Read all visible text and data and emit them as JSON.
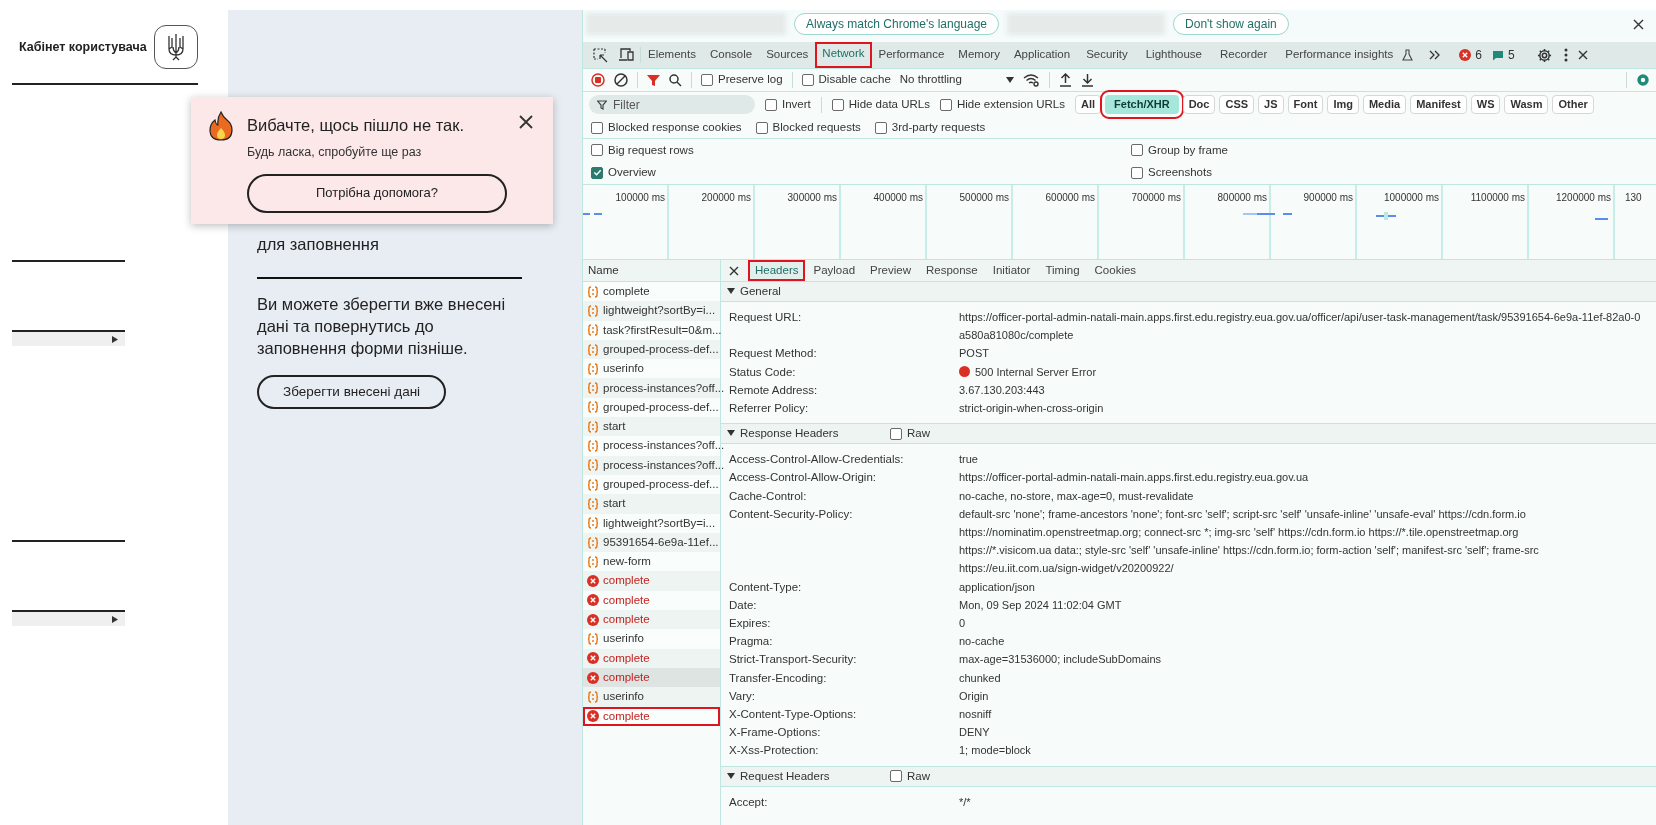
{
  "sidebar": {
    "title": "Кабінет користувача"
  },
  "main": {
    "form_note": "для заповнення",
    "save_hint": "Ви можете зберегти вже внесені дані та повернутись до заповнення форми пізніше.",
    "save_button": "Зберегти внесені дані"
  },
  "toast": {
    "title": "Вибачте, щось пішло не так.",
    "message": "Будь ласка, спробуйте ще раз",
    "button": "Потрібна допомога?"
  },
  "devtools": {
    "infobar": {
      "buttons": [
        "Always match Chrome's language",
        "Don't show again"
      ]
    },
    "tabs": [
      {
        "label": "Elements",
        "selected": false,
        "highlighted": false
      },
      {
        "label": "Console",
        "selected": false,
        "highlighted": false
      },
      {
        "label": "Sources",
        "selected": false,
        "highlighted": false
      },
      {
        "label": "Network",
        "selected": true,
        "highlighted": true
      },
      {
        "label": "Performance",
        "selected": false,
        "highlighted": false
      },
      {
        "label": "Memory",
        "selected": false,
        "highlighted": false
      },
      {
        "label": "Application",
        "selected": false,
        "highlighted": false
      },
      {
        "label": "Security",
        "selected": false,
        "highlighted": false
      },
      {
        "label": "Lighthouse",
        "selected": false,
        "highlighted": false
      },
      {
        "label": "Recorder",
        "selected": false,
        "highlighted": false
      },
      {
        "label": "Performance insights",
        "selected": false,
        "highlighted": false
      }
    ],
    "error_count": "6",
    "message_count": "5",
    "toolbar": {
      "checkboxes": [
        {
          "label": "Preserve log",
          "checked": false
        },
        {
          "label": "Disable cache",
          "checked": false
        }
      ],
      "throttling": "No throttling"
    },
    "filter": {
      "placeholder": "Filter",
      "checkboxes": [
        {
          "label": "Invert",
          "checked": false
        },
        {
          "label": "Hide data URLs",
          "checked": false
        },
        {
          "label": "Hide extension URLs",
          "checked": false
        }
      ],
      "types": [
        {
          "label": "All",
          "selected": false,
          "highlighted": false
        },
        {
          "label": "Fetch/XHR",
          "selected": true,
          "highlighted": true
        },
        {
          "label": "Doc",
          "selected": false,
          "highlighted": false
        },
        {
          "label": "CSS",
          "selected": false,
          "highlighted": false
        },
        {
          "label": "JS",
          "selected": false,
          "highlighted": false
        },
        {
          "label": "Font",
          "selected": false,
          "highlighted": false
        },
        {
          "label": "Img",
          "selected": false,
          "highlighted": false
        },
        {
          "label": "Media",
          "selected": false,
          "highlighted": false
        },
        {
          "label": "Manifest",
          "selected": false,
          "highlighted": false
        },
        {
          "label": "WS",
          "selected": false,
          "highlighted": false
        },
        {
          "label": "Wasm",
          "selected": false,
          "highlighted": false
        },
        {
          "label": "Other",
          "selected": false,
          "highlighted": false
        }
      ],
      "more_checkboxes": [
        {
          "label": "Blocked response cookies",
          "checked": false
        },
        {
          "label": "Blocked requests",
          "checked": false
        },
        {
          "label": "3rd-party requests",
          "checked": false
        }
      ]
    },
    "settings": {
      "left": [
        {
          "label": "Big request rows",
          "checked": false
        },
        {
          "label": "Overview",
          "checked": true
        }
      ],
      "right": [
        {
          "label": "Group by frame",
          "checked": false
        },
        {
          "label": "Screenshots",
          "checked": false
        }
      ]
    },
    "timeline": {
      "ticks": [
        "100000 ms",
        "200000 ms",
        "300000 ms",
        "400000 ms",
        "500000 ms",
        "600000 ms",
        "700000 ms",
        "800000 ms",
        "900000 ms",
        "1000000 ms",
        "1100000 ms",
        "1200000 ms",
        "130"
      ]
    },
    "requests": {
      "header": "Name",
      "items": [
        {
          "name": "complete",
          "kind": "fetch",
          "selected": false,
          "highlighted": false
        },
        {
          "name": "lightweight?sortBy=i...",
          "kind": "fetch",
          "selected": false,
          "highlighted": false
        },
        {
          "name": "task?firstResult=0&m...",
          "kind": "fetch",
          "selected": false,
          "highlighted": false
        },
        {
          "name": "grouped-process-def...",
          "kind": "fetch",
          "selected": false,
          "highlighted": false
        },
        {
          "name": "userinfo",
          "kind": "fetch",
          "selected": false,
          "highlighted": false
        },
        {
          "name": "process-instances?off...",
          "kind": "fetch",
          "selected": false,
          "highlighted": false
        },
        {
          "name": "grouped-process-def...",
          "kind": "fetch",
          "selected": false,
          "highlighted": false
        },
        {
          "name": "start",
          "kind": "fetch",
          "selected": false,
          "highlighted": false
        },
        {
          "name": "process-instances?off...",
          "kind": "fetch",
          "selected": false,
          "highlighted": false
        },
        {
          "name": "process-instances?off...",
          "kind": "fetch",
          "selected": false,
          "highlighted": false
        },
        {
          "name": "grouped-process-def...",
          "kind": "fetch",
          "selected": false,
          "highlighted": false
        },
        {
          "name": "start",
          "kind": "fetch",
          "selected": false,
          "highlighted": false
        },
        {
          "name": "lightweight?sortBy=i...",
          "kind": "fetch",
          "selected": false,
          "highlighted": false
        },
        {
          "name": "95391654-6e9a-11ef...",
          "kind": "fetch",
          "selected": false,
          "highlighted": false
        },
        {
          "name": "new-form",
          "kind": "fetch",
          "selected": false,
          "highlighted": false
        },
        {
          "name": "complete",
          "kind": "error",
          "selected": false,
          "highlighted": false
        },
        {
          "name": "complete",
          "kind": "error",
          "selected": false,
          "highlighted": false
        },
        {
          "name": "complete",
          "kind": "error",
          "selected": false,
          "highlighted": false
        },
        {
          "name": "userinfo",
          "kind": "fetch",
          "selected": false,
          "highlighted": false
        },
        {
          "name": "complete",
          "kind": "error",
          "selected": false,
          "highlighted": false
        },
        {
          "name": "complete",
          "kind": "error",
          "selected": true,
          "highlighted": false
        },
        {
          "name": "userinfo",
          "kind": "fetch",
          "selected": false,
          "highlighted": false
        },
        {
          "name": "complete",
          "kind": "error",
          "selected": false,
          "highlighted": true
        }
      ]
    },
    "detail_tabs": [
      {
        "label": "Headers",
        "selected": true,
        "highlighted": true
      },
      {
        "label": "Payload",
        "selected": false,
        "highlighted": false
      },
      {
        "label": "Preview",
        "selected": false,
        "highlighted": false
      },
      {
        "label": "Response",
        "selected": false,
        "highlighted": false
      },
      {
        "label": "Initiator",
        "selected": false,
        "highlighted": false
      },
      {
        "label": "Timing",
        "selected": false,
        "highlighted": false
      },
      {
        "label": "Cookies",
        "selected": false,
        "highlighted": false
      }
    ],
    "sections": [
      {
        "title": "General",
        "expanded": true,
        "rows": [
          {
            "key": "Request URL:",
            "kind": "text",
            "value": [
              "https://officer-portal-admin-natali-main.apps.first.edu.registry.eua.gov.ua/officer/api/user-task-management/task/95391654-6e9a-11ef-82a0-0",
              "a580a81080c/complete"
            ]
          },
          {
            "key": "Request Method:",
            "kind": "text",
            "value": [
              "POST"
            ]
          },
          {
            "key": "Status Code:",
            "kind": "status",
            "color": "#d93025",
            "value": [
              "500 Internal Server Error"
            ]
          },
          {
            "key": "Remote Address:",
            "kind": "text",
            "value": [
              "3.67.130.203:443"
            ]
          },
          {
            "key": "Referrer Policy:",
            "kind": "text",
            "value": [
              "strict-origin-when-cross-origin"
            ]
          }
        ]
      },
      {
        "title": "Response Headers",
        "expanded": true,
        "raw": {
          "label": "Raw",
          "checked": false
        },
        "rows": [
          {
            "key": "Access-Control-Allow-Credentials:",
            "kind": "text",
            "value": [
              "true"
            ]
          },
          {
            "key": "Access-Control-Allow-Origin:",
            "kind": "text",
            "value": [
              "https://officer-portal-admin-natali-main.apps.first.edu.registry.eua.gov.ua"
            ]
          },
          {
            "key": "Cache-Control:",
            "kind": "text",
            "value": [
              "no-cache, no-store, max-age=0, must-revalidate"
            ]
          },
          {
            "key": "Content-Security-Policy:",
            "kind": "text",
            "value": [
              "default-src 'none'; frame-ancestors 'none'; font-src 'self'; script-src 'self' 'unsafe-inline' 'unsafe-eval' https://cdn.form.io",
              "https://nominatim.openstreetmap.org; connect-src *; img-src 'self' https://cdn.form.io https://*.tile.openstreetmap.org",
              "https://*.visicom.ua data:; style-src 'self' 'unsafe-inline' https://cdn.form.io; form-action 'self'; manifest-src 'self'; frame-src",
              "https://eu.iit.com.ua/sign-widget/v20200922/"
            ]
          },
          {
            "key": "Content-Type:",
            "kind": "text",
            "value": [
              "application/json"
            ]
          },
          {
            "key": "Date:",
            "kind": "text",
            "value": [
              "Mon, 09 Sep 2024 11:02:04 GMT"
            ]
          },
          {
            "key": "Expires:",
            "kind": "text",
            "value": [
              "0"
            ]
          },
          {
            "key": "Pragma:",
            "kind": "text",
            "value": [
              "no-cache"
            ]
          },
          {
            "key": "Strict-Transport-Security:",
            "kind": "text",
            "value": [
              "max-age=31536000; includeSubDomains"
            ]
          },
          {
            "key": "Transfer-Encoding:",
            "kind": "text",
            "value": [
              "chunked"
            ]
          },
          {
            "key": "Vary:",
            "kind": "text",
            "value": [
              "Origin"
            ]
          },
          {
            "key": "X-Content-Type-Options:",
            "kind": "text",
            "value": [
              "nosniff"
            ]
          },
          {
            "key": "X-Frame-Options:",
            "kind": "text",
            "value": [
              "DENY"
            ]
          },
          {
            "key": "X-Xss-Protection:",
            "kind": "text",
            "value": [
              "1; mode=block"
            ]
          }
        ]
      },
      {
        "title": "Request Headers",
        "expanded": true,
        "raw": {
          "label": "Raw",
          "checked": false
        },
        "rows": [
          {
            "key": "Accept:",
            "kind": "text",
            "value": [
              "*/*"
            ]
          }
        ]
      }
    ]
  }
}
